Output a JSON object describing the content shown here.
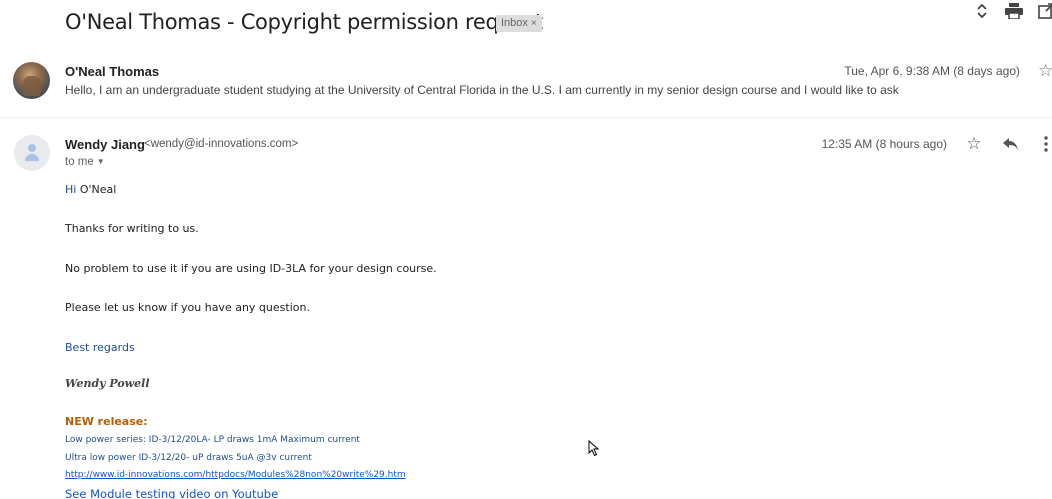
{
  "thread": {
    "subject": "O'Neal Thomas - Copyright permission request",
    "label": "Inbox",
    "label_close": "×"
  },
  "top_icons": [
    "expand-collapse-icon",
    "print-icon",
    "open-new-window-icon"
  ],
  "messages": [
    {
      "sender": "O'Neal Thomas",
      "snippet": "Hello, I am an undergraduate student studying at the University of Central Florida in the U.S. I am currently in my senior design course and I would like to ask",
      "date": "Tue, Apr 6, 9:38 AM (8 days ago)"
    },
    {
      "sender_name": "Wendy Jiang",
      "sender_email": "<wendy@id-innovations.com>",
      "to": "to me",
      "time": "12:35 AM (8 hours ago)",
      "body": {
        "greeting_hi": "Hi",
        "greeting_name": " O'Neal",
        "line1": "Thanks for writing to us.",
        "line2": "No problem to use it if you are using ID-3LA for your design course.",
        "line3": "Please let us know if you have any question.",
        "closing": "Best regards",
        "signature": "Wendy Powell",
        "release_title": "NEW release:",
        "release_line1": "Low power series:  ID-3/12/20LA- LP draws 1mA Maximum current",
        "release_line2": "Ultra low power ID-3/12/20- uP draws 5uA @3v current",
        "release_link": "http://www.id-innovations.com/httpdocs/Modules%28non%20write%29.htm",
        "video_link": "See Module testing video on Youtube"
      }
    }
  ]
}
